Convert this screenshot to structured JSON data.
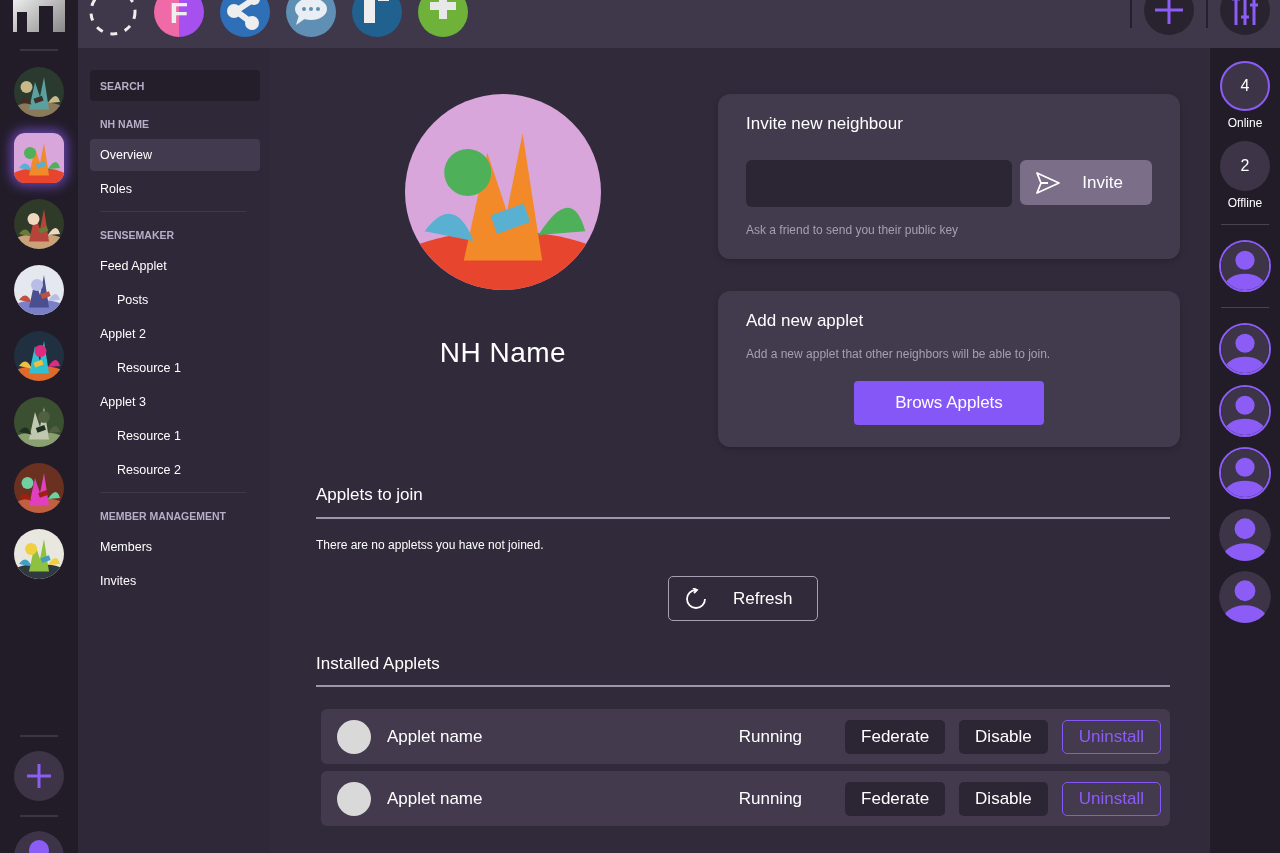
{
  "top_bar": {
    "apps": [
      {
        "kind": "dashed"
      },
      {
        "kind": "letter",
        "label": "F"
      },
      {
        "kind": "share"
      },
      {
        "kind": "chat"
      },
      {
        "kind": "board"
      },
      {
        "kind": "add"
      }
    ]
  },
  "left_rail": {
    "groups": [
      {
        "kind": "picture",
        "selected": false
      },
      {
        "kind": "picture",
        "selected": true
      },
      {
        "kind": "picture",
        "selected": false
      },
      {
        "kind": "picture",
        "selected": false
      },
      {
        "kind": "picture",
        "selected": false
      },
      {
        "kind": "picture",
        "selected": false
      },
      {
        "kind": "picture",
        "selected": false
      },
      {
        "kind": "picture",
        "selected": false
      }
    ]
  },
  "sidebar": {
    "search": {
      "placeholder": "SEARCH"
    },
    "sections": [
      {
        "heading": "NH NAME",
        "items": [
          {
            "label": "Overview",
            "selected": true
          },
          {
            "label": "Roles",
            "selected": false
          }
        ]
      },
      {
        "heading": "SENSEMAKER",
        "items": [
          {
            "label": "Feed Applet",
            "selected": false,
            "children": [
              {
                "label": "Posts",
                "selected": false
              }
            ]
          },
          {
            "label": "Applet 2",
            "selected": false,
            "children": [
              {
                "label": "Resource 1",
                "selected": false
              }
            ]
          },
          {
            "label": "Applet 3",
            "selected": false,
            "children": [
              {
                "label": "Resource 1",
                "selected": false
              },
              {
                "label": "Resource 2",
                "selected": false
              }
            ]
          }
        ]
      },
      {
        "heading": "MEMBER MANAGEMENT",
        "items": [
          {
            "label": "Members",
            "selected": false
          },
          {
            "label": "Invites",
            "selected": false
          }
        ]
      }
    ]
  },
  "profile": {
    "name": "NH Name"
  },
  "invite_card": {
    "title": "Invite new neighbour",
    "button": "Invite",
    "hint": "Ask a friend to send you their public key"
  },
  "add_applet_card": {
    "title": "Add new applet",
    "description": "Add a new applet that other neighbors will be able to join.",
    "button": "Brows Applets"
  },
  "applets_to_join": {
    "heading": "Applets to join",
    "message": "There are no appletss you have not joined.",
    "button": "Refresh"
  },
  "installed_applets": {
    "heading": "Installed Applets",
    "rows": [
      {
        "name": "Applet name",
        "status": "Running",
        "actions": [
          "Federate",
          "Disable",
          "Uninstall"
        ]
      },
      {
        "name": "Applet name",
        "status": "Running",
        "actions": [
          "Federate",
          "Disable",
          "Uninstall"
        ]
      }
    ]
  },
  "members_panel": {
    "online": {
      "count": "4",
      "label": "Online"
    },
    "offline": {
      "count": "2",
      "label": "Offline"
    },
    "self": {
      "online": true
    },
    "members": [
      {
        "online": true
      },
      {
        "online": true
      },
      {
        "online": true
      },
      {
        "online": false
      },
      {
        "online": false
      }
    ]
  }
}
